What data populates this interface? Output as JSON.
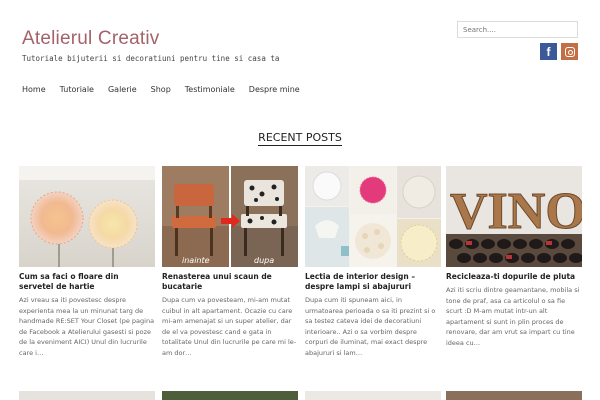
{
  "header": {
    "site_title": "Atelierul Creativ",
    "tagline": "Tutoriale bijuterii si decoratiuni pentru tine si casa ta",
    "search_placeholder": "Search....",
    "social": [
      "facebook-icon",
      "instagram-icon"
    ]
  },
  "nav": {
    "items": [
      "Home",
      "Tutoriale",
      "Galerie",
      "Shop",
      "Testimoniale",
      "Despre mine"
    ]
  },
  "main": {
    "section_title": "RECENT POSTS",
    "posts": [
      {
        "title": "Cum sa faci o floare din servetel de hartie",
        "excerpt": "Azi vreau sa iti povestesc despre experienta mea la un minunat targ de handmade RE:SET Your Closet (pe pagina de Facebook a Atelierului gasesti si poze de la eveniment AICI) Unul din lucrurile care i…"
      },
      {
        "title": "Renasterea unui scaun de bucatarie",
        "excerpt": "Dupa cum va povesteam, mi-am mutat cuibul in alt apartament. Ocazie cu care mi-am amenajat si un super atelier, dar de el va povestesc cand e gata in totalitate Unul din lucrurile pe care mi le-am dor…",
        "image_labels": [
          "inainte",
          "dupa"
        ]
      },
      {
        "title": "Lectia de interior design – despre lampi si abajururi",
        "excerpt": "Dupa cum iti spuneam aici, in urmatoarea perioada o sa iti prezint si o sa testez cateva idei de decoratiuni interioare.. Azi o sa vorbim despre corpuri de iluminat, mai exact despre abajururi si lam…"
      },
      {
        "title": "Recicleaza-ti dopurile de pluta",
        "excerpt": "Azi iti scriu dintre geamantane, mobila si tone de praf, asa ca articolul o sa fie scurt :D M-am mutat intr-un alt apartament si sunt in plin proces de renovare, dar am vrut sa impart cu tine ideea cu…",
        "image_text": "VINO"
      }
    ]
  }
}
